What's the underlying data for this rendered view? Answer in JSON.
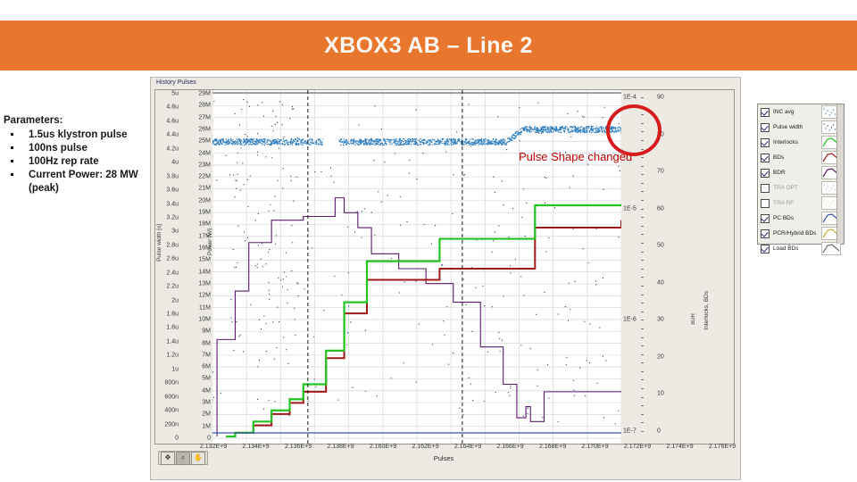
{
  "header": {
    "title": "XBOX3 AB – Line 2"
  },
  "parameters": {
    "title": "Parameters:",
    "items": [
      "1.5us klystron pulse",
      "100ns pulse",
      "100Hz rep rate",
      "Current Power: 28 MW (peak)"
    ]
  },
  "annotation": {
    "text": "Pulse Shape changed",
    "color": "#C00000",
    "circle_color": "#D61C1C"
  },
  "graph": {
    "label": "History Pulses",
    "tools": [
      "cursor-icon",
      "zoom-icon",
      "pan-icon"
    ],
    "active_tool": "zoom-icon"
  },
  "legend": {
    "rows": [
      {
        "label": "INC avg",
        "checked": true,
        "style": "scatter",
        "color": "#4a7fb5"
      },
      {
        "label": "Pulse width",
        "checked": true,
        "style": "scatter",
        "color": "#3d5f8a"
      },
      {
        "label": "Interlocks",
        "checked": true,
        "style": "line",
        "color": "#22C322"
      },
      {
        "label": "BDs",
        "checked": true,
        "style": "line",
        "color": "#A01818"
      },
      {
        "label": "BDR",
        "checked": true,
        "style": "line",
        "color": "#5B1A6B"
      },
      {
        "label": "TRA OPT",
        "checked": false,
        "style": "scatter",
        "color": "#b9b6d8"
      },
      {
        "label": "TRA RF",
        "checked": false,
        "style": "scatter",
        "color": "#ded9b0"
      },
      {
        "label": "PC BDs",
        "checked": true,
        "style": "line",
        "color": "#3b55a8"
      },
      {
        "label": "PCR/Hybrid BDs",
        "checked": true,
        "style": "line",
        "color": "#C9B23A"
      },
      {
        "label": "Load BDs",
        "checked": true,
        "style": "line",
        "color": "#6a6a6a"
      }
    ]
  },
  "chart_data": {
    "type": "line",
    "title": "History Pulses",
    "xlabel": "Pulses",
    "grid": true,
    "legend_position": "right",
    "x_ticks": [
      "2.132E+9",
      "2.134E+9",
      "2.136E+9",
      "2.138E+9",
      "2.160E+9",
      "2.162E+9",
      "2.164E+9",
      "2.166E+9",
      "2.168E+9",
      "2.170E+9",
      "2.172E+9",
      "2.174E+9",
      "2.176E+9"
    ],
    "xlim": [
      2.132,
      2.177
    ],
    "axes": [
      {
        "name": "Pulse width",
        "ylabel": "Pulse width [s]",
        "side": "left",
        "ticks": [
          "5u",
          "4.8u",
          "4.6u",
          "4.4u",
          "4.2u",
          "4u",
          "3.8u",
          "3.6u",
          "3.4u",
          "3.2u",
          "3u",
          "2.8u",
          "2.6u",
          "2.4u",
          "2.2u",
          "2u",
          "1.8u",
          "1.6u",
          "1.4u",
          "1.2u",
          "1u",
          "800n",
          "600n",
          "400n",
          "200n",
          "0"
        ],
        "ylim": [
          0,
          5e-06
        ]
      },
      {
        "name": "Power",
        "ylabel": "Power [W]",
        "side": "left",
        "ticks": [
          "29M",
          "28M",
          "27M",
          "26M",
          "25M",
          "24M",
          "23M",
          "22M",
          "21M",
          "20M",
          "19M",
          "18M",
          "17M",
          "16M",
          "15M",
          "14M",
          "13M",
          "12M",
          "11M",
          "10M",
          "9M",
          "8M",
          "7M",
          "6M",
          "5M",
          "4M",
          "3M",
          "2M",
          "1M",
          "0"
        ],
        "ylim": [
          0,
          29000000
        ]
      },
      {
        "name": "BDR",
        "ylabel": "BDR",
        "side": "right",
        "ticks": [
          "1E-4",
          "1E-5",
          "1E-6",
          "1E-7"
        ],
        "ylim": [
          1e-07,
          0.0001
        ],
        "scale": "log"
      },
      {
        "name": "Interlocks, BDs",
        "ylabel": "Interlocks, BDs",
        "side": "right",
        "ticks": [
          "90",
          "80",
          "70",
          "60",
          "50",
          "40",
          "30",
          "20",
          "10",
          "0"
        ],
        "ylim": [
          0,
          90
        ]
      }
    ],
    "series": [
      {
        "name": "INC avg",
        "color": "#4a7fb5",
        "style": "scatter",
        "description": "dense blue point band near 26M with step up at x=2.168E+9",
        "y_level_left": 26000000,
        "y_level_right": 26600000
      },
      {
        "name": "Pulse width",
        "color": "#2b4a72",
        "style": "scatter",
        "description": "sparse dark scatter spread over full plot"
      },
      {
        "name": "Interlocks",
        "color": "#22C322",
        "style": "step",
        "points": [
          [
            2.1335,
            0
          ],
          [
            2.1345,
            1
          ],
          [
            2.1365,
            4
          ],
          [
            2.1385,
            7
          ],
          [
            2.1405,
            10
          ],
          [
            2.142,
            14
          ],
          [
            2.1445,
            23
          ],
          [
            2.1465,
            36
          ],
          [
            2.149,
            47
          ],
          [
            2.1555,
            47
          ],
          [
            2.157,
            53
          ],
          [
            2.1655,
            53
          ],
          [
            2.1675,
            62
          ],
          [
            2.177,
            62
          ]
        ]
      },
      {
        "name": "BDs",
        "color": "#A01818",
        "style": "step",
        "points": [
          [
            2.1335,
            0
          ],
          [
            2.1345,
            1
          ],
          [
            2.1365,
            3
          ],
          [
            2.1385,
            6
          ],
          [
            2.1405,
            9
          ],
          [
            2.142,
            12
          ],
          [
            2.1445,
            21
          ],
          [
            2.1465,
            33
          ],
          [
            2.149,
            42
          ],
          [
            2.1555,
            42
          ],
          [
            2.157,
            45
          ],
          [
            2.1655,
            45
          ],
          [
            2.1675,
            56
          ],
          [
            2.177,
            58
          ]
        ]
      },
      {
        "name": "BDR",
        "color": "#5B1A6B",
        "style": "step",
        "points": [
          [
            2.1325,
            0
          ],
          [
            2.1325,
            26
          ],
          [
            2.1345,
            39
          ],
          [
            2.136,
            52
          ],
          [
            2.1385,
            58
          ],
          [
            2.142,
            59
          ],
          [
            2.1455,
            64
          ],
          [
            2.1465,
            60
          ],
          [
            2.148,
            56
          ],
          [
            2.1495,
            49
          ],
          [
            2.1525,
            45
          ],
          [
            2.1555,
            41
          ],
          [
            2.1585,
            36
          ],
          [
            2.1615,
            24
          ],
          [
            2.164,
            14
          ],
          [
            2.1655,
            5
          ],
          [
            2.1665,
            8
          ],
          [
            2.167,
            4
          ],
          [
            2.1685,
            12
          ],
          [
            2.177,
            12
          ]
        ]
      },
      {
        "name": "PC BDs",
        "color": "#3b55a8",
        "style": "step",
        "description": "flat blue line near zero across plot",
        "y_level": 0.5
      }
    ],
    "annotations": [
      {
        "text": "Pulse Shape changed",
        "color": "#C00000",
        "x": 2.1645,
        "y": 27500000
      },
      {
        "type": "circle",
        "color": "#D61C1C",
        "x": 2.1665,
        "y": 26400000
      }
    ],
    "cursor_lines": [
      2.1425,
      2.1595
    ]
  }
}
